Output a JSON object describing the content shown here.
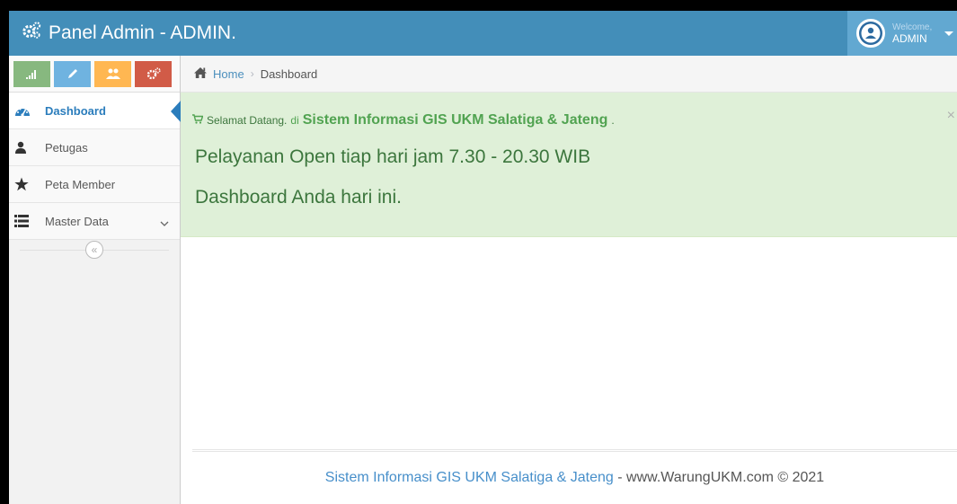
{
  "navbar": {
    "brand": "Panel Admin - ADMIN.",
    "welcome_label": "Welcome,",
    "user_name": "ADMIN"
  },
  "sidebar": {
    "shortcuts": [
      "signal-icon",
      "pencil-icon",
      "users-icon",
      "cogs-icon"
    ],
    "items": [
      {
        "label": "Dashboard",
        "icon": "tachometer-icon",
        "active": true
      },
      {
        "label": "Petugas",
        "icon": "user-icon"
      },
      {
        "label": "Peta Member",
        "icon": "star-icon"
      },
      {
        "label": "Master Data",
        "icon": "list-icon",
        "has_submenu": true
      }
    ],
    "collapse_symbol": "«"
  },
  "breadcrumb": {
    "home": "Home",
    "current": "Dashboard"
  },
  "alert": {
    "prefix": "Selamat Datang.",
    "di": "di",
    "system_name": "Sistem Informasi GIS UKM Salatiga & Jateng",
    "suffix": ".",
    "close": "×",
    "line2": "Pelayanan Open tiap hari jam 7.30 - 20.30 WIB",
    "line3": "Dashboard Anda hari ini."
  },
  "footer": {
    "system_name": "Sistem Informasi GIS UKM Salatiga & Jateng",
    "rest": " - www.WarungUKM.com © 2021"
  },
  "colors": {
    "navbar": "#438eb9",
    "alert_bg": "#dff0d8",
    "alert_text": "#3c763d",
    "active_accent": "#2b7dbc"
  }
}
